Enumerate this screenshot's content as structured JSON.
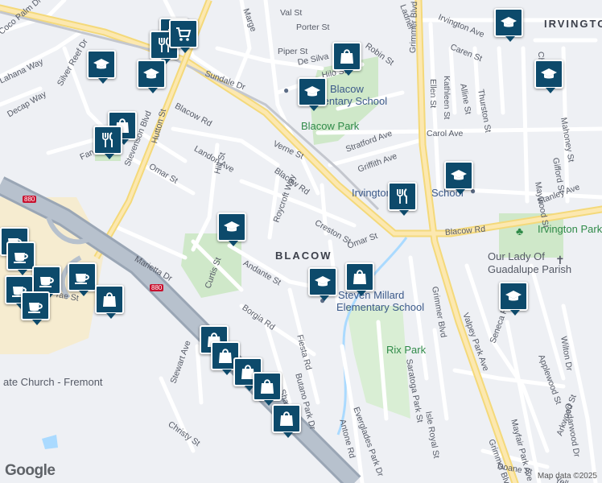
{
  "streets": [
    {
      "id": "val-st",
      "text": "Val St"
    },
    {
      "id": "porter-st",
      "text": "Porter St"
    },
    {
      "id": "piper-st",
      "text": "Piper St"
    },
    {
      "id": "de-silva",
      "text": "De Silva"
    },
    {
      "id": "hilo-st",
      "text": "Hilo St"
    },
    {
      "id": "robin-st",
      "text": "Robin St"
    },
    {
      "id": "ladner",
      "text": "Ladner"
    },
    {
      "id": "irvington-ave",
      "text": "Irvington Ave"
    },
    {
      "id": "caren-st",
      "text": "Caren St"
    },
    {
      "id": "kathleen-st",
      "text": "Kathleen St"
    },
    {
      "id": "ellen-st",
      "text": "Ellen St"
    },
    {
      "id": "alline-st",
      "text": "Alline St"
    },
    {
      "id": "thurston-st",
      "text": "Thurston St"
    },
    {
      "id": "chapel",
      "text": "Chap"
    },
    {
      "id": "mahoney-st",
      "text": "Mahoney St"
    },
    {
      "id": "carol-ave",
      "text": "Carol Ave"
    },
    {
      "id": "stratford-ave",
      "text": "Stratford Ave"
    },
    {
      "id": "griffith-ave",
      "text": "Griffith Ave"
    },
    {
      "id": "gifford-st",
      "text": "Gifford St"
    },
    {
      "id": "maywood-st",
      "text": "Maywood St"
    },
    {
      "id": "stanley-ave",
      "text": "Stanley Ave"
    },
    {
      "id": "blacow-rd-1",
      "text": "Blacow Rd"
    },
    {
      "id": "blacow-rd-2",
      "text": "Blacow Rd"
    },
    {
      "id": "blacow-rd-3",
      "text": "Blacow Rd"
    },
    {
      "id": "sundale-dr",
      "text": "Sundale Dr"
    },
    {
      "id": "margery",
      "text": "Marge"
    },
    {
      "id": "verne-st",
      "text": "Verne St"
    },
    {
      "id": "landon-ave",
      "text": "Landon Ave"
    },
    {
      "id": "hutton-st",
      "text": "Hutton St"
    },
    {
      "id": "omar-st-1",
      "text": "Omar St"
    },
    {
      "id": "omar-st-2",
      "text": "Omar St"
    },
    {
      "id": "hill-st",
      "text": "Hill St"
    },
    {
      "id": "roycroft-way",
      "text": "Roycroft Way"
    },
    {
      "id": "creston-st",
      "text": "Creston St"
    },
    {
      "id": "stevenson-blvd",
      "text": "Stevenson Blvd"
    },
    {
      "id": "grimmer-blvd-1",
      "text": "Grimmer Blvd"
    },
    {
      "id": "grimmer-blvd-2",
      "text": "Grimmer Blvd"
    },
    {
      "id": "grimmer-blvd-3",
      "text": "Grimmer Blvd"
    },
    {
      "id": "coco-palm-dr",
      "text": "Coco Palm Dr"
    },
    {
      "id": "silver-reef-dr",
      "text": "Silver Reef Dr"
    },
    {
      "id": "lahana-way",
      "text": "Lahana Way"
    },
    {
      "id": "decap-way",
      "text": "Decap Way"
    },
    {
      "id": "farwell",
      "text": "Farwe"
    },
    {
      "id": "marietta-dr",
      "text": "Marietta Dr"
    },
    {
      "id": "curtis-st",
      "text": "Curtis St"
    },
    {
      "id": "andante-st",
      "text": "Andante St"
    },
    {
      "id": "borgia-rd",
      "text": "Borgia Rd"
    },
    {
      "id": "fiesta-rd",
      "text": "Fiesta Rd"
    },
    {
      "id": "butano-park-dr",
      "text": "Butano Park Dr"
    },
    {
      "id": "shana-st",
      "text": "Shana St"
    },
    {
      "id": "stewart-ave",
      "text": "Stewart Ave"
    },
    {
      "id": "christy-st",
      "text": "Christy St"
    },
    {
      "id": "antone-rd",
      "text": "Antone Rd"
    },
    {
      "id": "everglades-park-dr",
      "text": "Everglades Park Dr"
    },
    {
      "id": "saratoga-park-st",
      "text": "Saratoga Park St"
    },
    {
      "id": "isle-royal-st",
      "text": "Isle Royal St"
    },
    {
      "id": "valpey-park-ave",
      "text": "Valpey Park Ave"
    },
    {
      "id": "seneca-park-ave",
      "text": "Seneca Park Ave"
    },
    {
      "id": "mayfair-park-ave",
      "text": "Mayfair Park Ave"
    },
    {
      "id": "applewood-st",
      "text": "Applewood St"
    },
    {
      "id": "wilton-dr",
      "text": "Wilton Dr"
    },
    {
      "id": "cedarwood-dr",
      "text": "Cedarwood Dr"
    },
    {
      "id": "arkwood-st",
      "text": "Arkwood St"
    },
    {
      "id": "doane-st",
      "text": "Doane St"
    },
    {
      "id": "yell",
      "text": "Yell"
    },
    {
      "id": "rae-st",
      "text": "rae St"
    }
  ],
  "places": {
    "irvington": "IRVINGTON",
    "blacow": "BLACOW",
    "blacow_park": "Blacow Park",
    "blacow_school_1": "Blacow",
    "blacow_school_2": "Elementary School",
    "irvington_school": "Irvington",
    "irvington_school_2": "School",
    "irvington_park": "Irvington Park",
    "our_lady_1": "Our Lady Of",
    "our_lady_2": "Guadalupe Parish",
    "millard_1": "Steven Millard",
    "millard_2": "Elementary School",
    "rix_park": "Rix Park",
    "church": "ate Church - Fremont",
    "shield_880_a": "880",
    "shield_880_b": "880"
  },
  "attribution": {
    "logo": "Google",
    "credit": "Map data ©2025"
  },
  "pins": [
    {
      "id": "school-top-left",
      "icon": "school-icon"
    },
    {
      "id": "shop-top",
      "icon": "shopping-bag-icon"
    },
    {
      "id": "restaurant-top",
      "icon": "restaurant-icon"
    },
    {
      "id": "cart-top",
      "icon": "cart-icon"
    },
    {
      "id": "school-left",
      "icon": "school-icon"
    },
    {
      "id": "shop-farwell",
      "icon": "shopping-bag-icon"
    },
    {
      "id": "restaurant-farwell",
      "icon": "restaurant-icon"
    },
    {
      "id": "shop-desilva",
      "icon": "shopping-bag-icon"
    },
    {
      "id": "school-blacow",
      "icon": "school-icon"
    },
    {
      "id": "school-irvington-top",
      "icon": "school-icon"
    },
    {
      "id": "school-chapel",
      "icon": "school-icon"
    },
    {
      "id": "school-irvington",
      "icon": "school-icon"
    },
    {
      "id": "restaurant-irvington",
      "icon": "restaurant-icon"
    },
    {
      "id": "school-hill",
      "icon": "school-icon"
    },
    {
      "id": "school-millard",
      "icon": "school-icon"
    },
    {
      "id": "shop-millard",
      "icon": "shopping-bag-icon"
    },
    {
      "id": "school-seneca",
      "icon": "school-icon"
    },
    {
      "id": "cafe-1",
      "icon": "cafe-icon"
    },
    {
      "id": "cafe-2",
      "icon": "cafe-icon"
    },
    {
      "id": "cafe-3",
      "icon": "cafe-icon"
    },
    {
      "id": "cafe-4",
      "icon": "cafe-icon"
    },
    {
      "id": "cafe-5",
      "icon": "cafe-icon"
    },
    {
      "id": "cafe-6",
      "icon": "cafe-icon"
    },
    {
      "id": "shop-mall",
      "icon": "shopping-bag-icon"
    },
    {
      "id": "shop-stewart-1",
      "icon": "shopping-bag-icon"
    },
    {
      "id": "shop-stewart-2",
      "icon": "shopping-bag-icon"
    },
    {
      "id": "shop-stewart-3",
      "icon": "shopping-bag-icon"
    },
    {
      "id": "shop-stewart-4",
      "icon": "shopping-bag-icon"
    },
    {
      "id": "shop-stewart-5",
      "icon": "shopping-bag-icon"
    }
  ]
}
